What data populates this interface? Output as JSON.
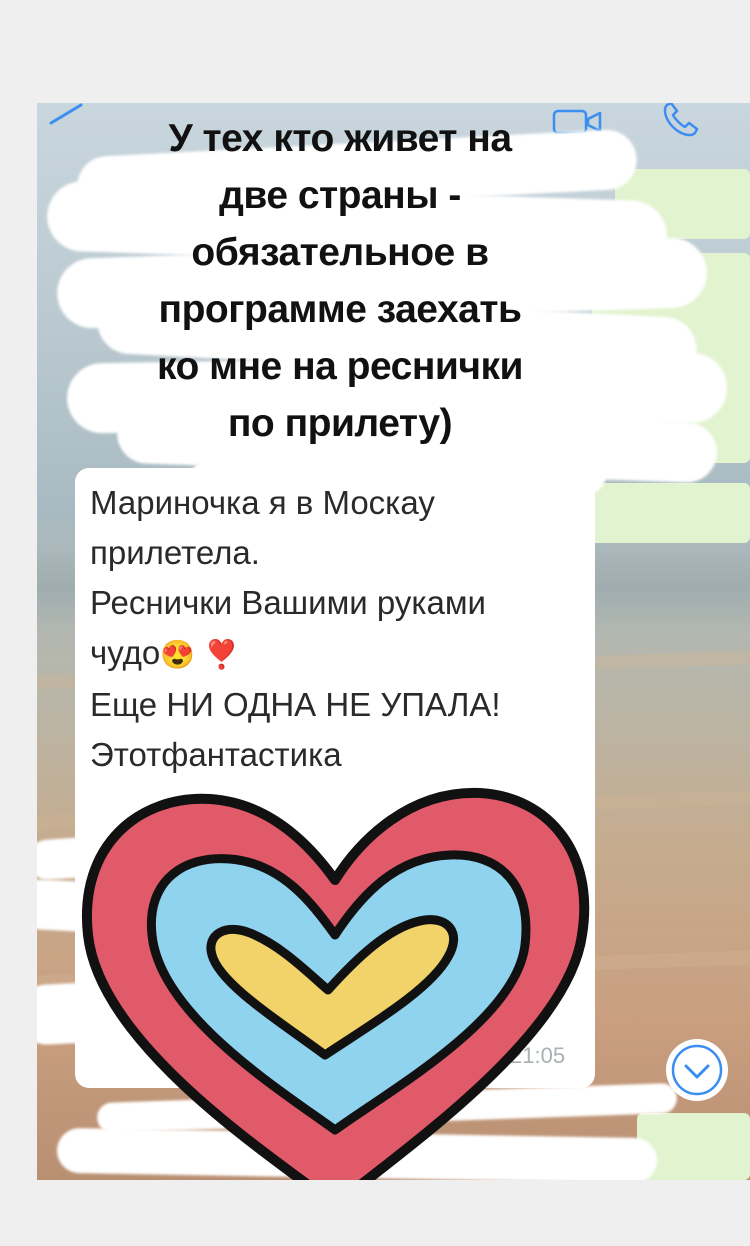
{
  "story": {
    "caption_lines": [
      "У тех кто живет на",
      "две страны -",
      "обязательное в",
      "программе заехать",
      "ко мне на реснички",
      "по прилету)"
    ]
  },
  "header": {
    "video_call_icon": "video-camera-icon",
    "phone_call_icon": "phone-icon"
  },
  "message": {
    "lines": [
      "Мариночка я в Москау",
      "прилетела.",
      "Реснички Вашими руками",
      "чудо",
      "Еще НИ ОДНА НЕ УПАЛА!",
      "Этотфантастика"
    ],
    "emoji_love": "😍",
    "emoji_heart": "❣️",
    "time": "21:05"
  },
  "controls": {
    "scroll_down_icon": "chevron-down-circle-icon"
  },
  "sticker": {
    "name": "heart-sticker",
    "colors": {
      "outer": "#e05a6a",
      "middle": "#8fd3ef",
      "inner": "#f2d36a",
      "outline": "#111111"
    }
  }
}
